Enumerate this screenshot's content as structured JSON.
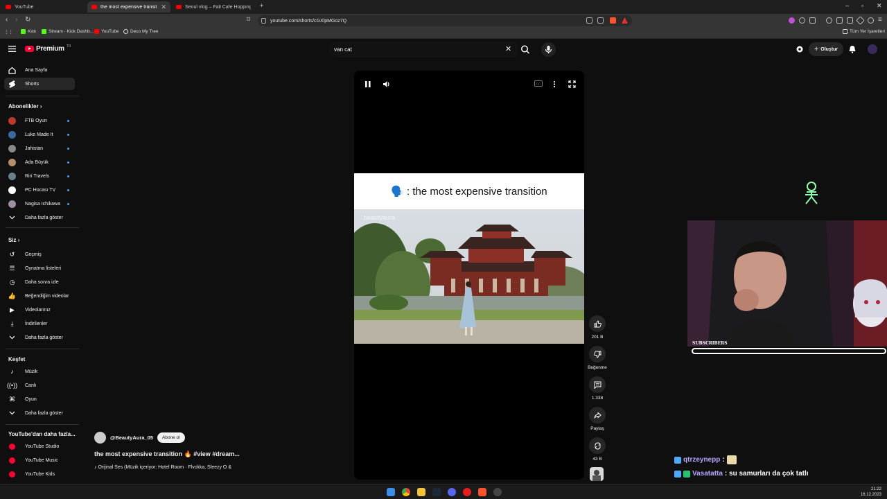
{
  "browser": {
    "tabs": [
      {
        "title": "YouTube"
      },
      {
        "title": "the most expensive transition"
      },
      {
        "title": "Seoul vlog – Fall Cafe Hopping, Top..."
      }
    ],
    "url": "youtube.com/shorts/cGXlpMGoz7Q",
    "bookmarks": [
      "Kick",
      "Stream - Kick Dashb...",
      "YouTube",
      "Deco My Tree"
    ],
    "all_bookmarks": "Tüm Yer İşaretleri"
  },
  "youtube": {
    "logo_text": "Premium",
    "logo_region": "TR",
    "search_value": "van cat",
    "create_label": "Oluştur"
  },
  "sidebar": {
    "main": [
      {
        "label": "Ana Sayfa",
        "icon": "home-icon"
      },
      {
        "label": "Shorts",
        "icon": "shorts-icon"
      }
    ],
    "subscriptions_header": "Abonelikler",
    "subscriptions": [
      {
        "label": "FTB Oyun",
        "avatar": "#c0392b"
      },
      {
        "label": "Luke Made It",
        "avatar": "#3b6aa0"
      },
      {
        "label": "Jahistan",
        "avatar": "#888888"
      },
      {
        "label": "Ada Büyük",
        "avatar": "#b58f6a"
      },
      {
        "label": "Riri Travels",
        "avatar": "#6a7f8c"
      },
      {
        "label": "PC Hocası TV",
        "avatar": "#ffffff"
      },
      {
        "label": "Nagisa Ichikawa",
        "avatar": "#9b8fa0"
      }
    ],
    "show_more": "Daha fazla göster",
    "you_header": "Siz",
    "you": [
      {
        "label": "Geçmiş",
        "icon": "history-icon"
      },
      {
        "label": "Oynatma listeleri",
        "icon": "playlists-icon"
      },
      {
        "label": "Daha sonra izle",
        "icon": "watch-later-icon"
      },
      {
        "label": "Beğendiğim videolar",
        "icon": "liked-icon"
      },
      {
        "label": "Videolarınız",
        "icon": "your-videos-icon"
      },
      {
        "label": "İndirilenler",
        "icon": "download-icon"
      },
      {
        "label": "Daha fazla göster",
        "icon": "chevron-down-icon"
      }
    ],
    "explore_header": "Keşfet",
    "explore": [
      {
        "label": "Müzik",
        "icon": "music-icon"
      },
      {
        "label": "Canlı",
        "icon": "live-icon"
      },
      {
        "label": "Oyun",
        "icon": "gaming-icon"
      },
      {
        "label": "Daha fazla göster",
        "icon": "chevron-down-icon"
      }
    ],
    "more_header": "YouTube'dan daha fazla...",
    "more": [
      {
        "label": "YouTube Studio"
      },
      {
        "label": "YouTube Music"
      },
      {
        "label": "YouTube Kids"
      }
    ]
  },
  "short": {
    "overlay_caption": ": the most expensive transition",
    "watermark": "beautyaura",
    "channel": "@BeautyAura_05",
    "subscribe_label": "Abone ol",
    "title": "the most expensive transition 🔥 #view #dream...",
    "audio": "♪ Orijinal Ses (Müzik içeriyor: Hotel Room · Flvckka, Sleezy O &"
  },
  "actions": {
    "likes": "201 B",
    "dislike": "Beğenme",
    "comments": "1.338",
    "share": "Paylaş",
    "remix": "43 B"
  },
  "stream": {
    "subscribers_label": "SUBSCRIBERS",
    "chat": [
      {
        "user": "qtrzeynepp",
        "message": ""
      },
      {
        "user": "Vasatatta",
        "message": ": su samurları da çok tatlı"
      }
    ]
  },
  "taskbar": {
    "time": "21:22",
    "date": "16.12.2023"
  },
  "colors": {
    "yt_red": "#ff0033",
    "bg": "#0f0f0f",
    "subscribe_dot": "#3ea6ff",
    "chat_user": "#b9a5ff"
  }
}
